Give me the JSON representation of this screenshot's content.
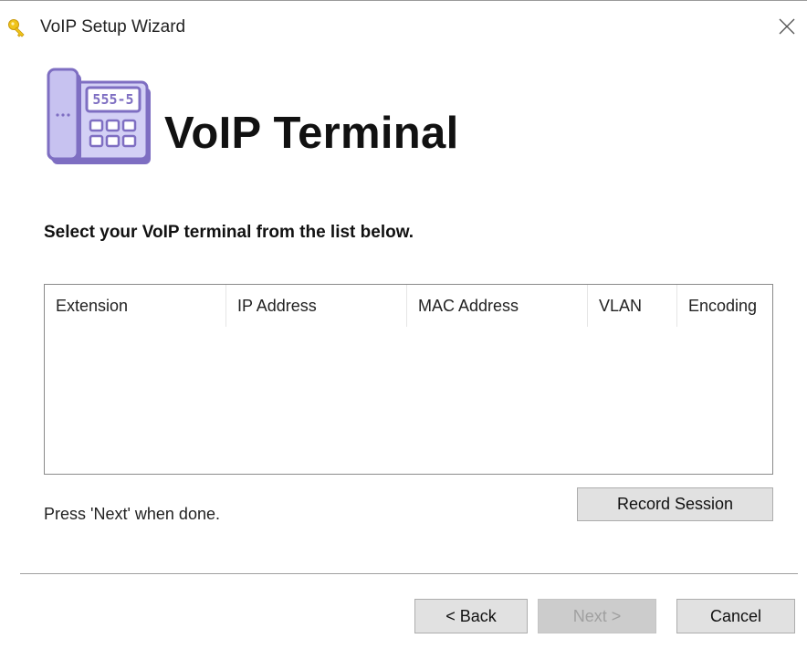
{
  "window": {
    "title": "VoIP Setup Wizard",
    "icon": "key-icon",
    "close_icon": "close-icon"
  },
  "header": {
    "title": "VoIP Terminal",
    "logo_icon": "desk-phone-icon",
    "logo_display_text": "555-5"
  },
  "instruction": "Select your VoIP terminal from the list below.",
  "terminal_list": {
    "columns": [
      "Extension",
      "IP Address",
      "MAC Address",
      "VLAN",
      "Encoding"
    ],
    "rows": []
  },
  "status_text": "Press 'Next' when done.",
  "buttons": {
    "record_session": "Record Session",
    "back": "< Back",
    "next": "Next >",
    "cancel": "Cancel"
  },
  "colors": {
    "logo_purple": "#7e6ec2",
    "logo_light": "#d3d0f5",
    "key_yellow": "#f0c419"
  }
}
